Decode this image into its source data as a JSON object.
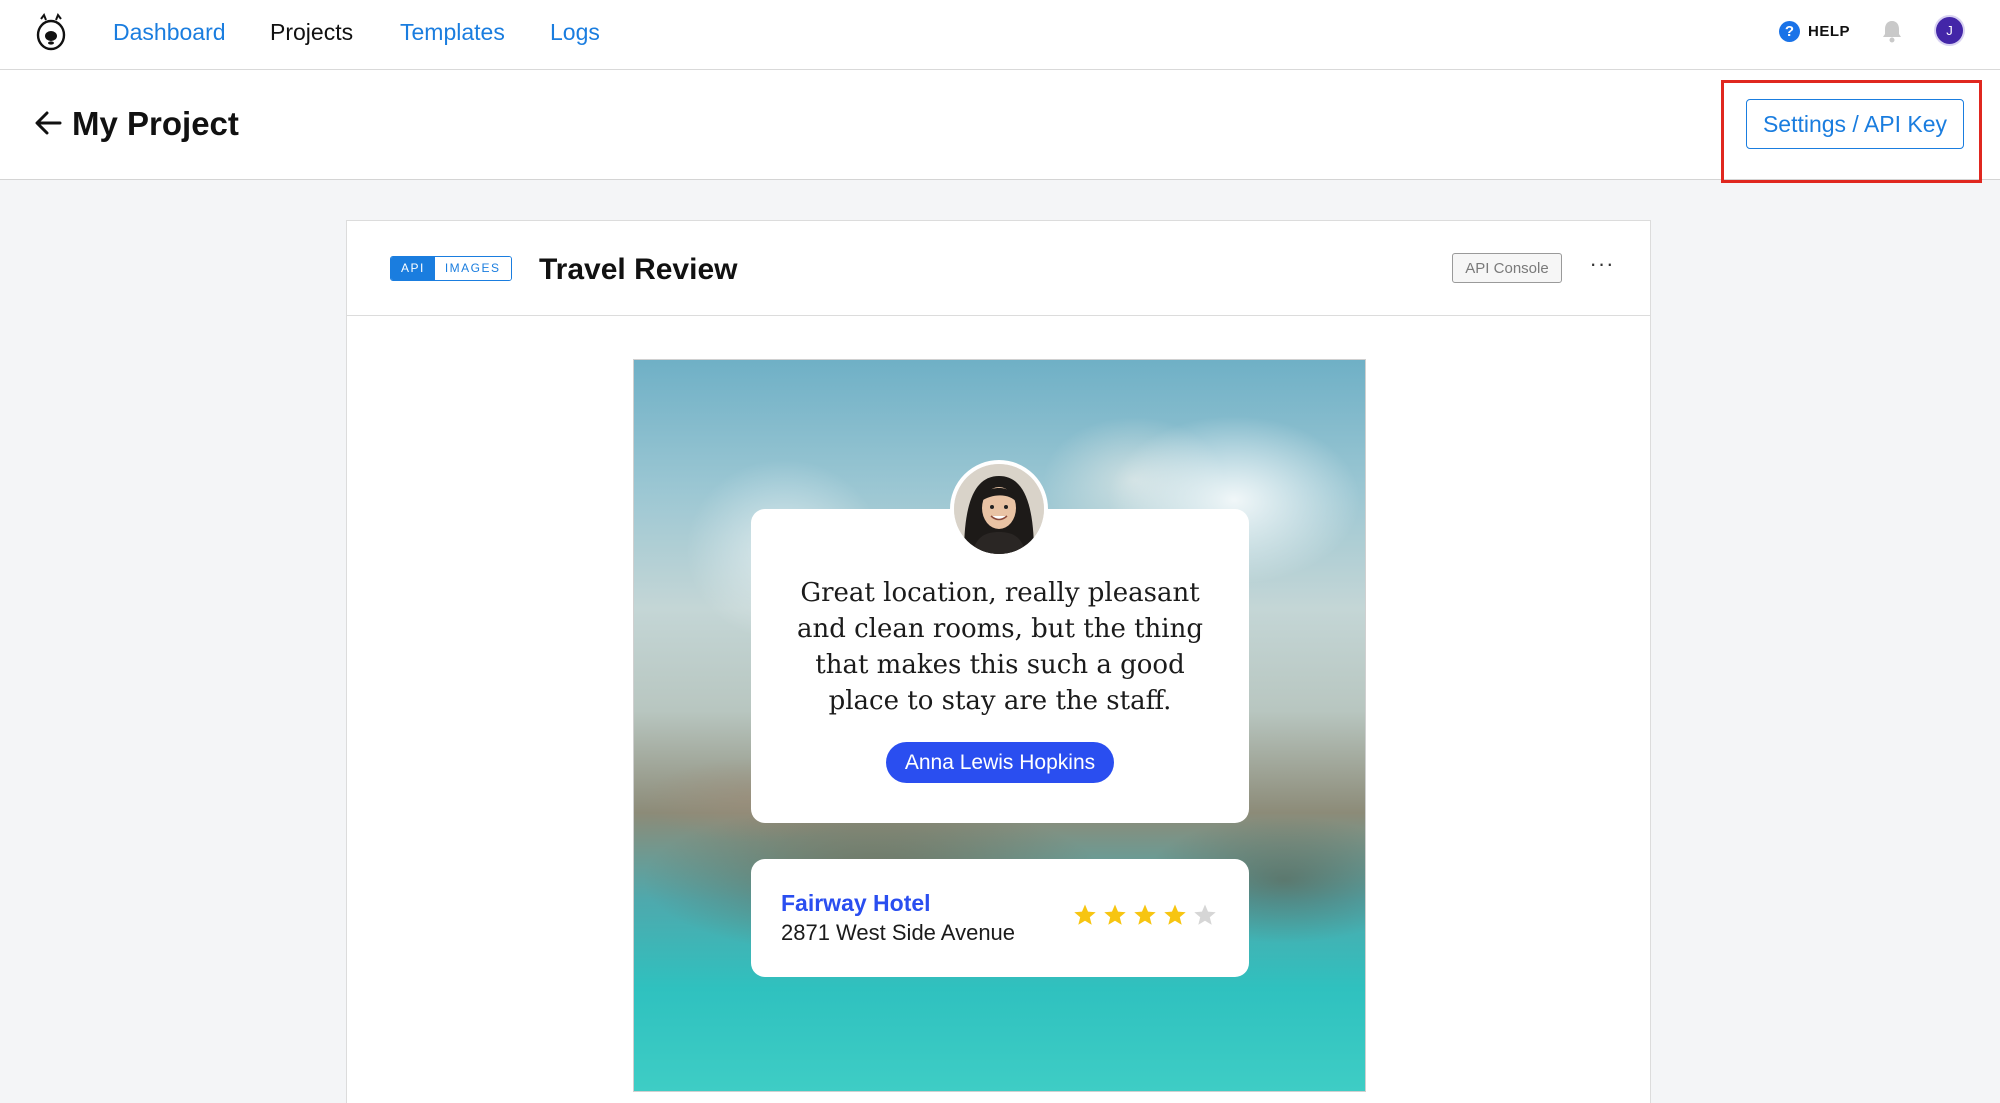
{
  "nav": {
    "links": [
      "Dashboard",
      "Projects",
      "Templates",
      "Logs"
    ],
    "active": "Projects",
    "help_label": "HELP",
    "avatar_initial": "J"
  },
  "header": {
    "title": "My Project",
    "settings_label": "Settings / API Key"
  },
  "card": {
    "tags": [
      "API",
      "IMAGES"
    ],
    "title": "Travel Review",
    "console_label": "API Console",
    "more_label": "···"
  },
  "preview": {
    "quote": "Great location, really pleasant and clean rooms, but the thing that makes this such a good place to stay are the staff.",
    "reviewer": "Anna Lewis Hopkins",
    "hotel_name": "Fairway Hotel",
    "hotel_address": "2871 West Side Avenue",
    "rating": 4,
    "rating_max": 5
  },
  "colors": {
    "link": "#1a7ddf",
    "highlight": "#e0271f",
    "accent": "#2a4ef0",
    "star": "#f7c511",
    "star_empty": "#d6d6d6"
  }
}
